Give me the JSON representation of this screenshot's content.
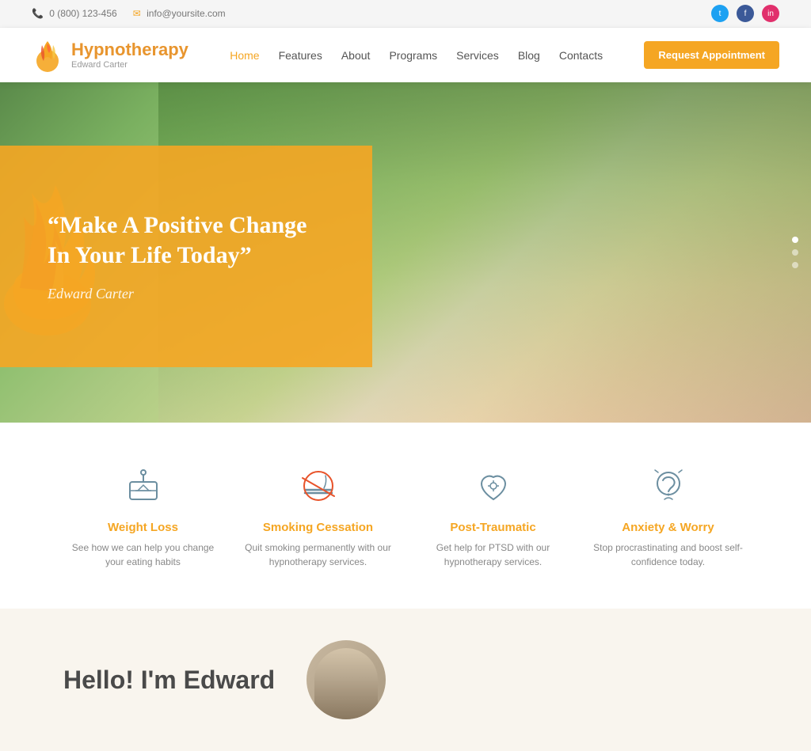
{
  "topbar": {
    "phone": "0 (800) 123-456",
    "email": "info@yoursite.com",
    "phone_icon": "📞",
    "email_icon": "✉"
  },
  "header": {
    "logo_title": "Hypnotherapy",
    "logo_subtitle": "Edward Carter",
    "nav_items": [
      {
        "label": "Home",
        "active": true
      },
      {
        "label": "Features",
        "active": false
      },
      {
        "label": "About",
        "active": false
      },
      {
        "label": "Programs",
        "active": false
      },
      {
        "label": "Services",
        "active": false
      },
      {
        "label": "Blog",
        "active": false
      },
      {
        "label": "Contacts",
        "active": false
      }
    ],
    "cta_button": "Request Appointment"
  },
  "hero": {
    "quote": "“Make A Positive Change In Your Life Today”",
    "author": "Edward Carter",
    "slider_dots": 3,
    "active_dot": 0
  },
  "services": [
    {
      "id": "weight-loss",
      "title": "Weight Loss",
      "description": "See how we can help you change your eating habits"
    },
    {
      "id": "smoking",
      "title": "Smoking Cessation",
      "description": "Quit smoking permanently with our hypnotherapy services."
    },
    {
      "id": "ptsd",
      "title": "Post-Traumatic",
      "description": "Get help for PTSD with our hypnotherapy services."
    },
    {
      "id": "anxiety",
      "title": "Anxiety & Worry",
      "description": "Stop procrastinating and boost self-confidence today."
    }
  ],
  "bottom": {
    "title": "Hello! I'm Edward"
  },
  "colors": {
    "accent": "#f5a623",
    "accent_light": "#f9a825",
    "text_dark": "#4a4a4a",
    "text_gray": "#888888"
  }
}
